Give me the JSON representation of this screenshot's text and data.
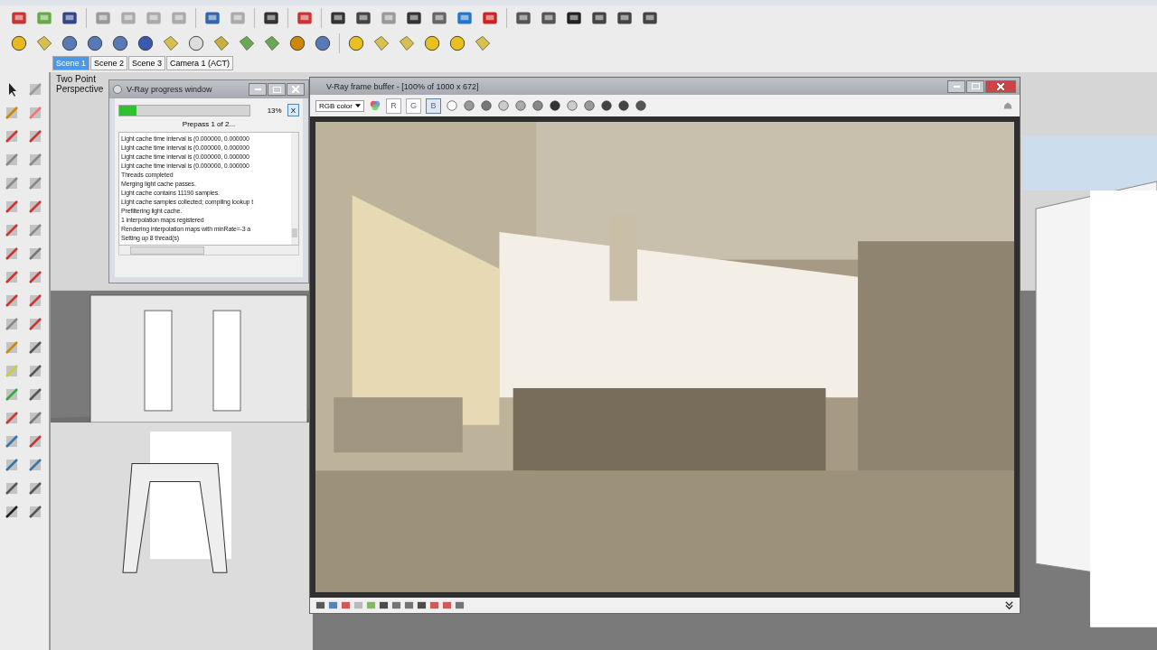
{
  "scene_tabs": [
    {
      "label": "Scene 1",
      "selected": true
    },
    {
      "label": "Scene 2",
      "selected": false
    },
    {
      "label": "Scene 3",
      "selected": false
    },
    {
      "label": "Camera 1 (ACT)",
      "selected": false
    }
  ],
  "viewport": {
    "label": "Two Point Perspective"
  },
  "progress_window": {
    "title": "V-Ray progress window",
    "level": 0.13,
    "percent": "13%",
    "cancel": "X",
    "status": "Prepass 1 of 2...",
    "log": [
      "Light cache time interval is (0.000000, 0.000000",
      "Light cache time interval is (0.000000, 0.000000",
      "Light cache time interval is (0.000000, 0.000000",
      "Light cache time interval is (0.000000, 0.000000",
      "Threads completed",
      "Merging light cache passes.",
      "Light cache contains 11190 samples.",
      "Light cache samples collected; compiling lookup t",
      "Prefiltering light cache.",
      "1 interpolation maps registered",
      "Rendering interpolation maps with minRate=-3 a",
      "Setting up 8 thread(s)"
    ]
  },
  "frame_buffer": {
    "title": "V-Ray frame buffer - [100% of 1000 x 672]",
    "channel": "RGB color",
    "channel_buttons": [
      {
        "label": "R",
        "selected": false
      },
      {
        "label": "G",
        "selected": false
      },
      {
        "label": "B",
        "selected": true
      }
    ]
  }
}
